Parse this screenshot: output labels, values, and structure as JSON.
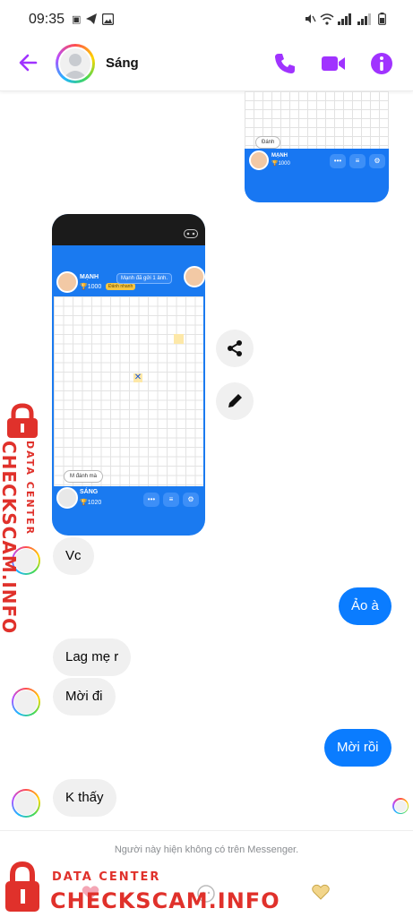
{
  "status_bar": {
    "time": "09:35"
  },
  "header": {
    "contact_name": "Sáng"
  },
  "shot1": {
    "mini_bubble": "Đánh",
    "player_name": "MẠNH",
    "score": "🏆1000"
  },
  "shot2": {
    "top_name": "MẠNH",
    "top_score": "🏆1000",
    "top_badge": "Đánh nhanh",
    "notice": "Mạnh đã gửi 1 ảnh.",
    "mini_bubble": "M đánh mà",
    "bottom_name": "SÁNG",
    "bottom_score": "🏆1020"
  },
  "messages": [
    {
      "text": "Vc",
      "side": "in"
    },
    {
      "text": "Ảo à",
      "side": "out"
    },
    {
      "text": "Lag mẹ r",
      "side": "in"
    },
    {
      "text": "Mời đi",
      "side": "in"
    },
    {
      "text": "Mời rồi",
      "side": "out"
    },
    {
      "text": "K thấy",
      "side": "in"
    }
  ],
  "footer": {
    "note": "Người này hiện không có trên Messenger."
  },
  "watermark": {
    "side_big": "CHECKSCAM.INFO",
    "side_small": "DATA CENTER",
    "bottom_big": "CHECKSCAM.INFO",
    "bottom_small": "DATA CENTER"
  },
  "colors": {
    "accent": "#a033ff",
    "bubble_out": "#0a7cff",
    "bubble_in": "#f0f0f0",
    "watermark": "#e0312b"
  },
  "icons": [
    "back-arrow-icon",
    "phone-icon",
    "video-icon",
    "info-icon",
    "share-icon",
    "pencil-icon",
    "lock-icon"
  ]
}
